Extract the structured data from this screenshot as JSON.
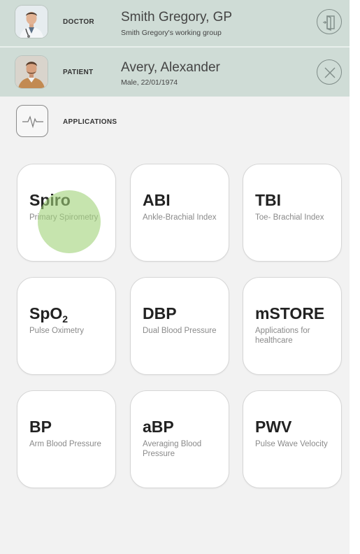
{
  "doctor": {
    "role_label": "DOCTOR",
    "name": "Smith Gregory, GP",
    "subline": "Smith Gregory's working group",
    "action_icon": "logout-door-icon"
  },
  "patient": {
    "role_label": "PATIENT",
    "name": "Avery, Alexander",
    "subline": "Male, 22/01/1974",
    "action_icon": "close-icon"
  },
  "applications": {
    "label": "APPLICATIONS",
    "icon": "pulse-waveform-icon"
  },
  "tiles": [
    {
      "title": "Spiro",
      "subtitle": "Primary Spirometry"
    },
    {
      "title": "ABI",
      "subtitle": "Ankle-Brachial Index"
    },
    {
      "title": "TBI",
      "subtitle": "Toe- Brachial Index"
    },
    {
      "title_main": "SpO",
      "title_sub": "2",
      "subtitle": "Pulse Oximetry"
    },
    {
      "title": "DBP",
      "subtitle": "Dual Blood Pressure"
    },
    {
      "title": "mSTORE",
      "subtitle": "Applications for healthcare"
    },
    {
      "title": "BP",
      "subtitle": "Arm Blood Pressure"
    },
    {
      "title": "aBP",
      "subtitle": "Averaging Blood Pressure"
    },
    {
      "title": "PWV",
      "subtitle": "Pulse Wave Velocity"
    }
  ],
  "colors": {
    "header_bg": "#cfdcd6",
    "page_bg": "#f2f2f2",
    "touch_indicator": "#a0d278"
  }
}
